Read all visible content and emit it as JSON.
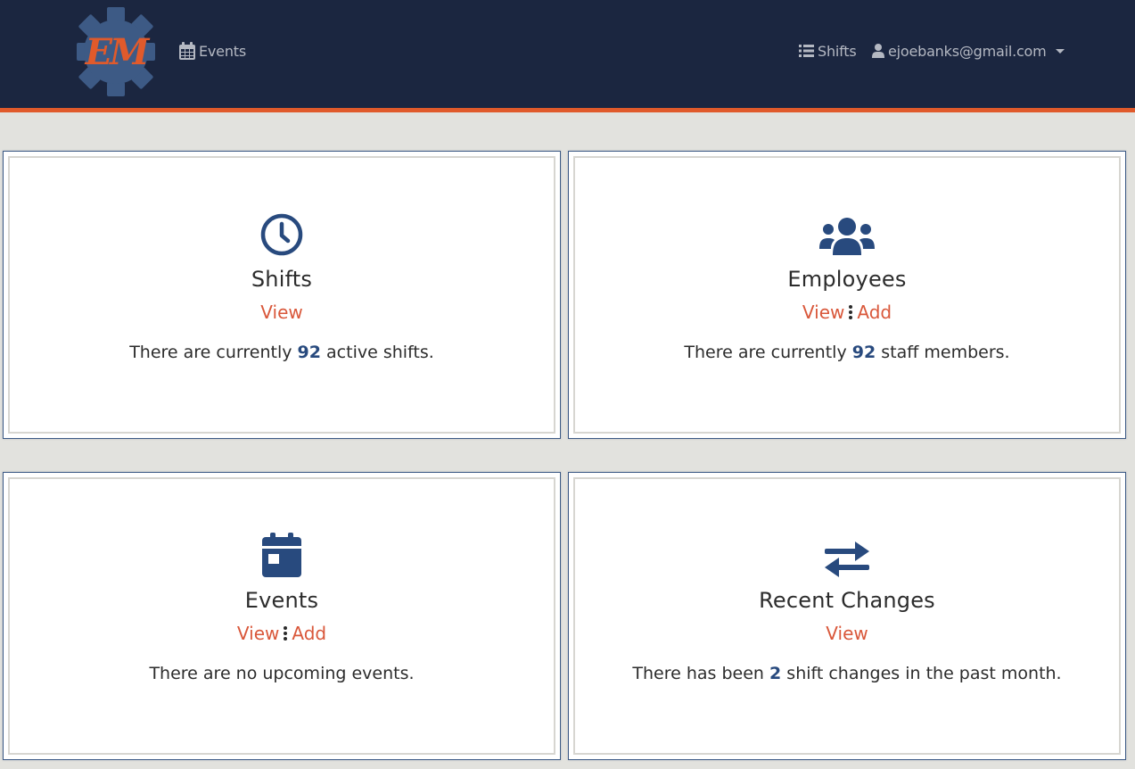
{
  "header": {
    "brand_initials": "EM",
    "nav_events_label": "Events",
    "nav_shifts_label": "Shifts",
    "user_email": "ejoebanks@gmail.com"
  },
  "colors": {
    "navbar_bg": "#1b2640",
    "accent": "#e05a2b",
    "icon_blue": "#284a7e",
    "link": "#d9573a"
  },
  "cards": {
    "shifts": {
      "icon": "clock-icon",
      "title": "Shifts",
      "view_label": "View",
      "desc_prefix": "There are currently",
      "count": "92",
      "desc_suffix": "active shifts."
    },
    "employees": {
      "icon": "users-icon",
      "title": "Employees",
      "view_label": "View",
      "add_label": "Add",
      "desc_prefix": "There are currently",
      "count": "92",
      "desc_suffix": "staff members."
    },
    "events": {
      "icon": "calendar-icon",
      "title": "Events",
      "view_label": "View",
      "add_label": "Add",
      "desc": "There are no upcoming events."
    },
    "recent_changes": {
      "icon": "exchange-arrows-icon",
      "title": "Recent Changes",
      "view_label": "View",
      "desc_prefix": "There has been",
      "count": "2",
      "desc_suffix": "shift changes in the past month."
    }
  }
}
